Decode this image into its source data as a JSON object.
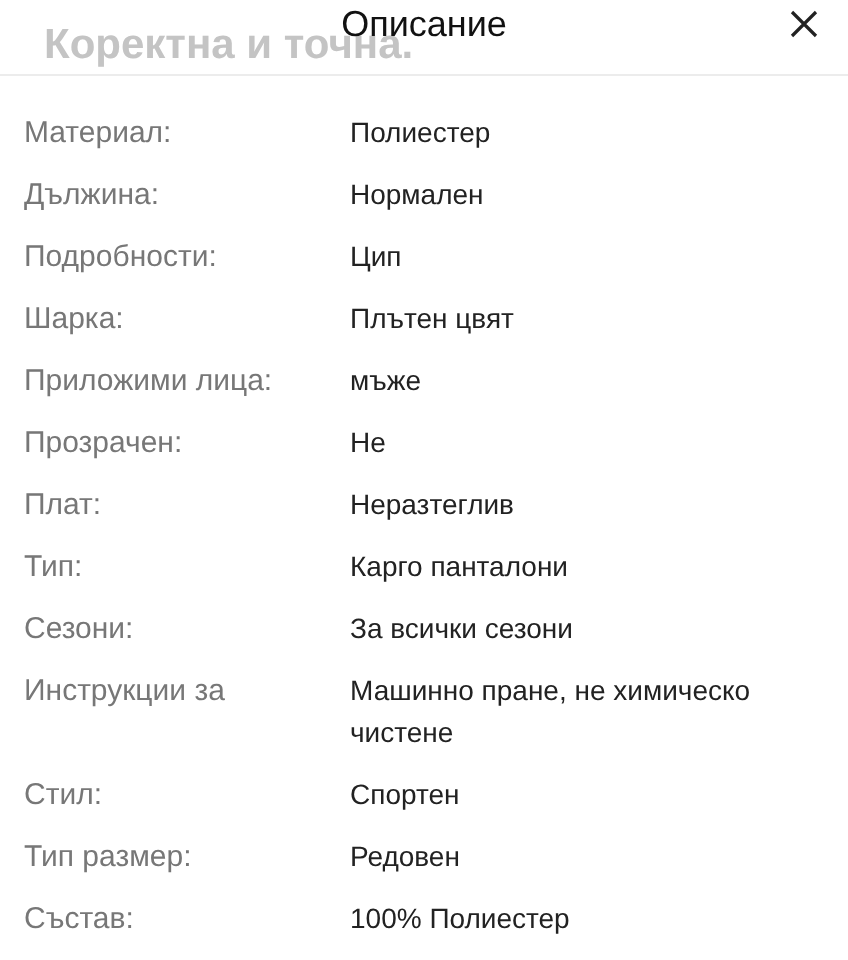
{
  "background_text": "Коректна и точна.",
  "header": {
    "title": "Описание"
  },
  "attributes": [
    {
      "label": "Материал:",
      "value": "Полиестер"
    },
    {
      "label": "Дължина:",
      "value": "Нормален"
    },
    {
      "label": "Подробности:",
      "value": "Цип"
    },
    {
      "label": "Шарка:",
      "value": "Плътен цвят"
    },
    {
      "label": "Приложими лица:",
      "value": "мъже"
    },
    {
      "label": "Прозрачен:",
      "value": "Не"
    },
    {
      "label": "Плат:",
      "value": "Неразтеглив"
    },
    {
      "label": "Тип:",
      "value": "Карго панталони"
    },
    {
      "label": "Сезони:",
      "value": "За всички сезони"
    },
    {
      "label": "Инструкции за",
      "value": "Машинно пране, не химическо чистене"
    },
    {
      "label": "Стил:",
      "value": "Спортен"
    },
    {
      "label": "Тип размер:",
      "value": "Редовен"
    },
    {
      "label": "Състав:",
      "value": "100% Полиестер"
    }
  ]
}
